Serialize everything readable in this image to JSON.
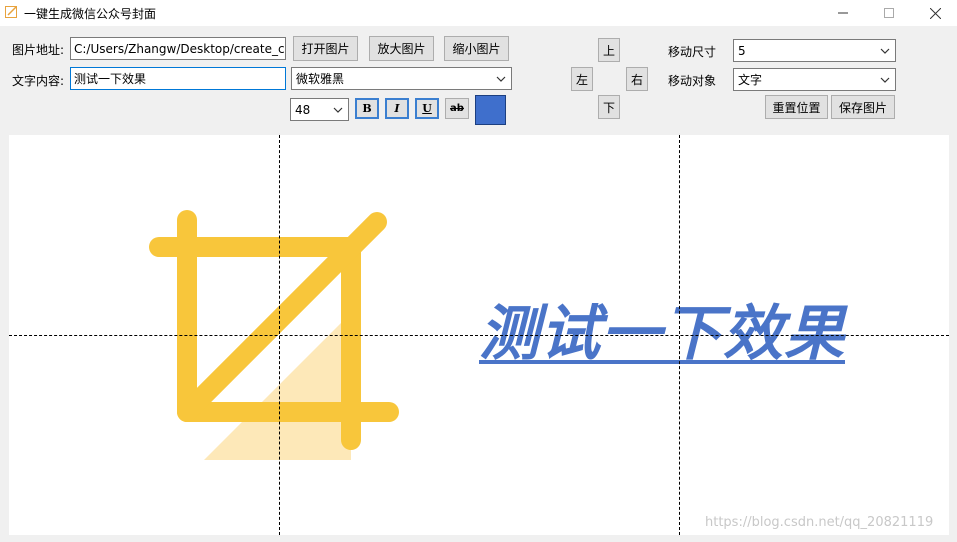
{
  "window": {
    "title": "一键生成微信公众号封面"
  },
  "form": {
    "image_path_label": "图片地址:",
    "image_path_value": "C:/Users/Zhangw/Desktop/create_cc",
    "open_image_label": "打开图片",
    "zoom_in_label": "放大图片",
    "zoom_out_label": "缩小图片",
    "text_content_label": "文字内容:",
    "text_content_value": "测试一下效果",
    "font_family": "微软雅黑",
    "font_size": "48",
    "bold_label": "B",
    "italic_label": "I",
    "underline_label": "U",
    "strike_label": "ab",
    "text_color": "#3f6fcc"
  },
  "move": {
    "up_label": "上",
    "left_label": "左",
    "right_label": "右",
    "down_label": "下",
    "step_label": "移动尺寸",
    "step_value": "5",
    "target_label": "移动对象",
    "target_value": "文字",
    "reset_label": "重置位置",
    "save_label": "保存图片"
  },
  "preview": {
    "text": "测试一下效果",
    "icon": "crop-icon",
    "icon_color": "#f8c63b",
    "icon_fill_color": "#fde8b8",
    "watermark": "https://blog.csdn.net/qq_20821119"
  }
}
